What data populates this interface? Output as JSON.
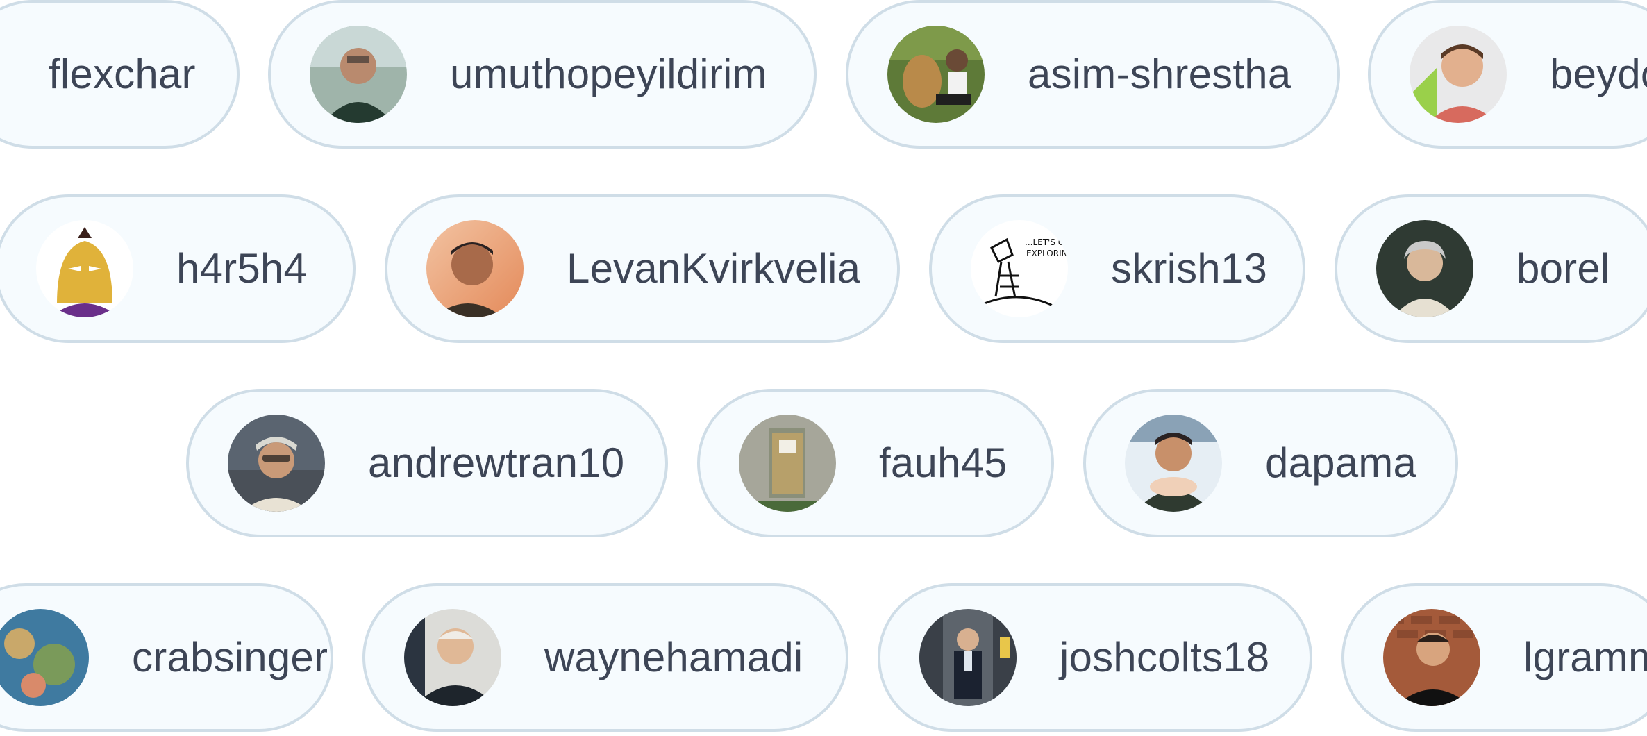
{
  "contributors": [
    {
      "username": "flexchar",
      "avatar": "partial-avatar",
      "avatar_color": "#8a8f93"
    },
    {
      "username": "umuthopeyildirim",
      "avatar": "person-avatar",
      "avatar_color": "#7d9a8a"
    },
    {
      "username": "asim-shrestha",
      "avatar": "person-with-dog-avatar",
      "avatar_color": "#6f8a3c"
    },
    {
      "username": "beydo",
      "avatar": "person-avatar",
      "avatar_color": "#9ad04a"
    },
    {
      "username": "h4r5h4",
      "avatar": "cartoon-avatar",
      "avatar_color": "#e0b23a"
    },
    {
      "username": "LevanKvirkvelia",
      "avatar": "person-avatar",
      "avatar_color": "#e9a57a"
    },
    {
      "username": "skrish13",
      "avatar": "comic-drawing-avatar",
      "avatar_color": "#dedede"
    },
    {
      "username": "borel",
      "avatar": "portrait-painting-avatar",
      "avatar_color": "#2f3a33"
    },
    {
      "username": "andrewtran10",
      "avatar": "person-avatar",
      "avatar_color": "#5a6470"
    },
    {
      "username": "fauh45",
      "avatar": "door-photo-avatar",
      "avatar_color": "#9a9a8e"
    },
    {
      "username": "dapama",
      "avatar": "person-avatar",
      "avatar_color": "#b9c9d6"
    },
    {
      "username": "crabsinger",
      "avatar": "partial-avatar",
      "avatar_color": "#3f7aa0"
    },
    {
      "username": "waynehamadi",
      "avatar": "person-avatar",
      "avatar_color": "#2b3440"
    },
    {
      "username": "joshcolts18",
      "avatar": "person-avatar",
      "avatar_color": "#5d646c"
    },
    {
      "username": "lgramm",
      "avatar": "person-avatar",
      "avatar_color": "#a45a3a"
    }
  ]
}
